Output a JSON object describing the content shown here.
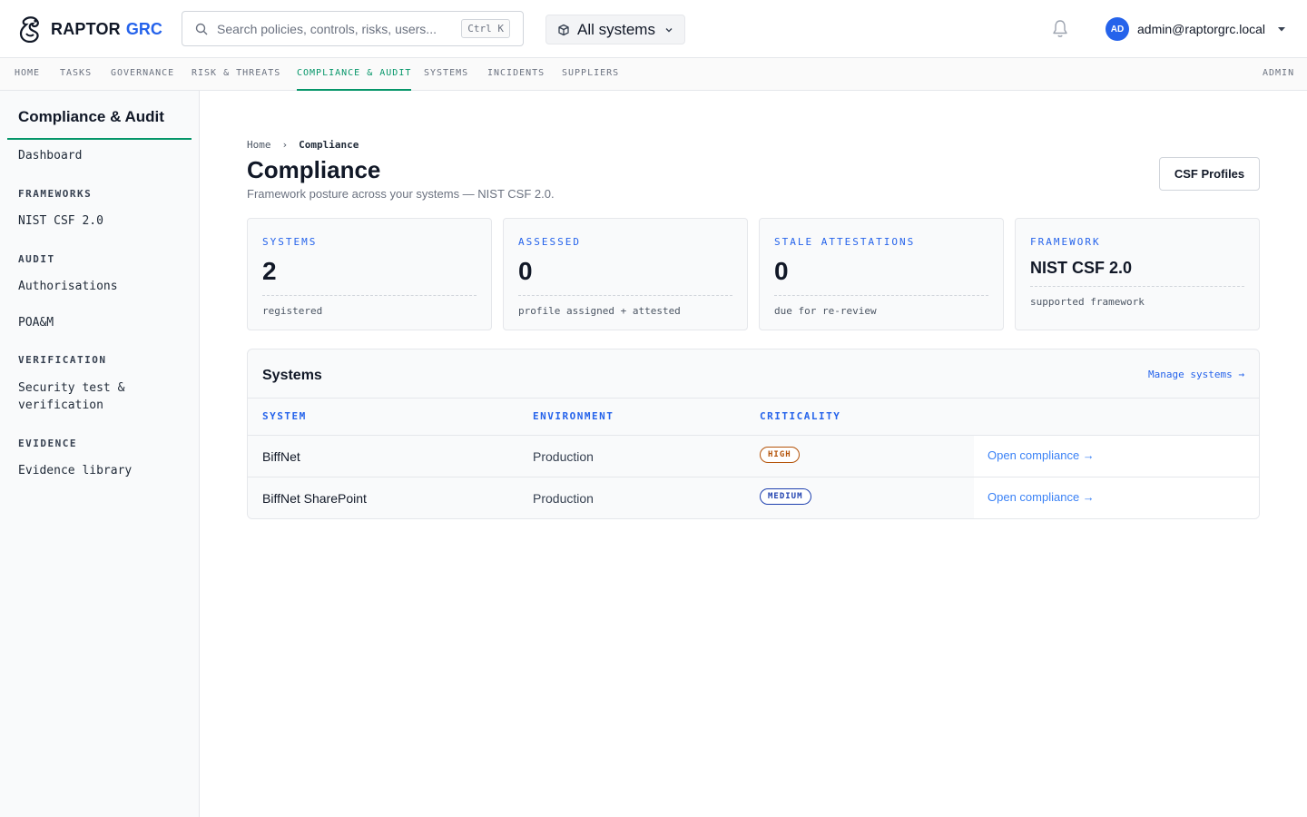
{
  "brand": {
    "name": "RAPTOR",
    "accent": "GRC"
  },
  "search": {
    "placeholder": "Search policies, controls, risks, users...",
    "shortcut": "Ctrl K"
  },
  "system_selector": {
    "label": "All systems"
  },
  "user": {
    "initials": "AD",
    "email": "admin@raptorgrc.local"
  },
  "nav": {
    "items": [
      {
        "label": "HOME"
      },
      {
        "label": "TASKS"
      },
      {
        "label": "GOVERNANCE"
      },
      {
        "label": "RISK & THREATS"
      },
      {
        "label": "COMPLIANCE & AUDIT",
        "active": true
      },
      {
        "label": "SYSTEMS"
      },
      {
        "label": "INCIDENTS"
      },
      {
        "label": "SUPPLIERS"
      }
    ],
    "admin": "ADMIN"
  },
  "sidebar": {
    "title": "Compliance & Audit",
    "dashboard": "Dashboard",
    "sections": [
      {
        "heading": "FRAMEWORKS",
        "items": [
          "NIST CSF 2.0"
        ]
      },
      {
        "heading": "AUDIT",
        "items": [
          "Authorisations",
          "POA&M"
        ]
      },
      {
        "heading": "VERIFICATION",
        "items": [
          "Security test & verification"
        ]
      },
      {
        "heading": "EVIDENCE",
        "items": [
          "Evidence library"
        ]
      }
    ],
    "verification_line1": "Security test &",
    "verification_line2": "verification"
  },
  "page": {
    "breadcrumb": {
      "home": "Home",
      "sep": "›",
      "current": "Compliance"
    },
    "title": "Compliance",
    "subtitle": "Framework posture across your systems — NIST CSF 2.0.",
    "action_button": "CSF Profiles"
  },
  "stats": [
    {
      "label": "SYSTEMS",
      "value": "2",
      "note": "registered"
    },
    {
      "label": "ASSESSED",
      "value": "0",
      "note": "profile assigned + attested"
    },
    {
      "label": "STALE ATTESTATIONS",
      "value": "0",
      "note": "due for re-review"
    },
    {
      "label": "FRAMEWORK",
      "value": "NIST CSF 2.0",
      "note": "supported framework"
    }
  ],
  "systems_panel": {
    "title": "Systems",
    "manage_link": "Manage systems →",
    "columns": [
      "SYSTEM",
      "ENVIRONMENT",
      "CRITICALITY"
    ],
    "rows": [
      {
        "system": "BiffNet",
        "environment": "Production",
        "criticality": "HIGH",
        "action": "Open compliance →"
      },
      {
        "system": "BiffNet SharePoint",
        "environment": "Production",
        "criticality": "MEDIUM",
        "action": "Open compliance →"
      }
    ]
  },
  "colors": {
    "accent_green": "#059669",
    "accent_blue": "#2563eb",
    "high": "#b45309",
    "medium": "#1e40af"
  },
  "icons": {
    "logo": "raptor-logo-icon",
    "search": "search-icon",
    "system": "cube-icon",
    "chevron": "chevron-down-icon",
    "bell": "bell-icon",
    "caret": "caret-down-icon"
  }
}
